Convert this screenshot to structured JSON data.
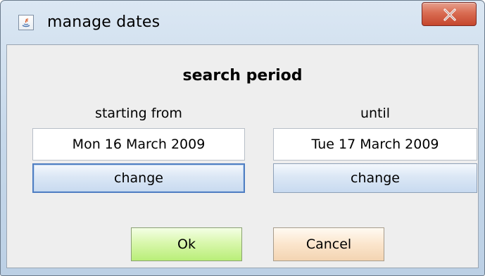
{
  "window": {
    "title": "manage dates",
    "app_icon": "java-app-icon",
    "close_icon": "close-icon"
  },
  "dialog": {
    "section_title": "search period",
    "starting_label": "starting from",
    "until_label": "until",
    "start_date": "Mon 16 March 2009",
    "end_date": "Tue 17 March 2009",
    "change_left": "change",
    "change_right": "change",
    "ok": "Ok",
    "cancel": "Cancel"
  },
  "colors": {
    "title_close": "#d96c52",
    "ok_green": "#b9ee78",
    "cancel_peach": "#f3d4b2",
    "focus_blue": "#4f7ec2"
  }
}
